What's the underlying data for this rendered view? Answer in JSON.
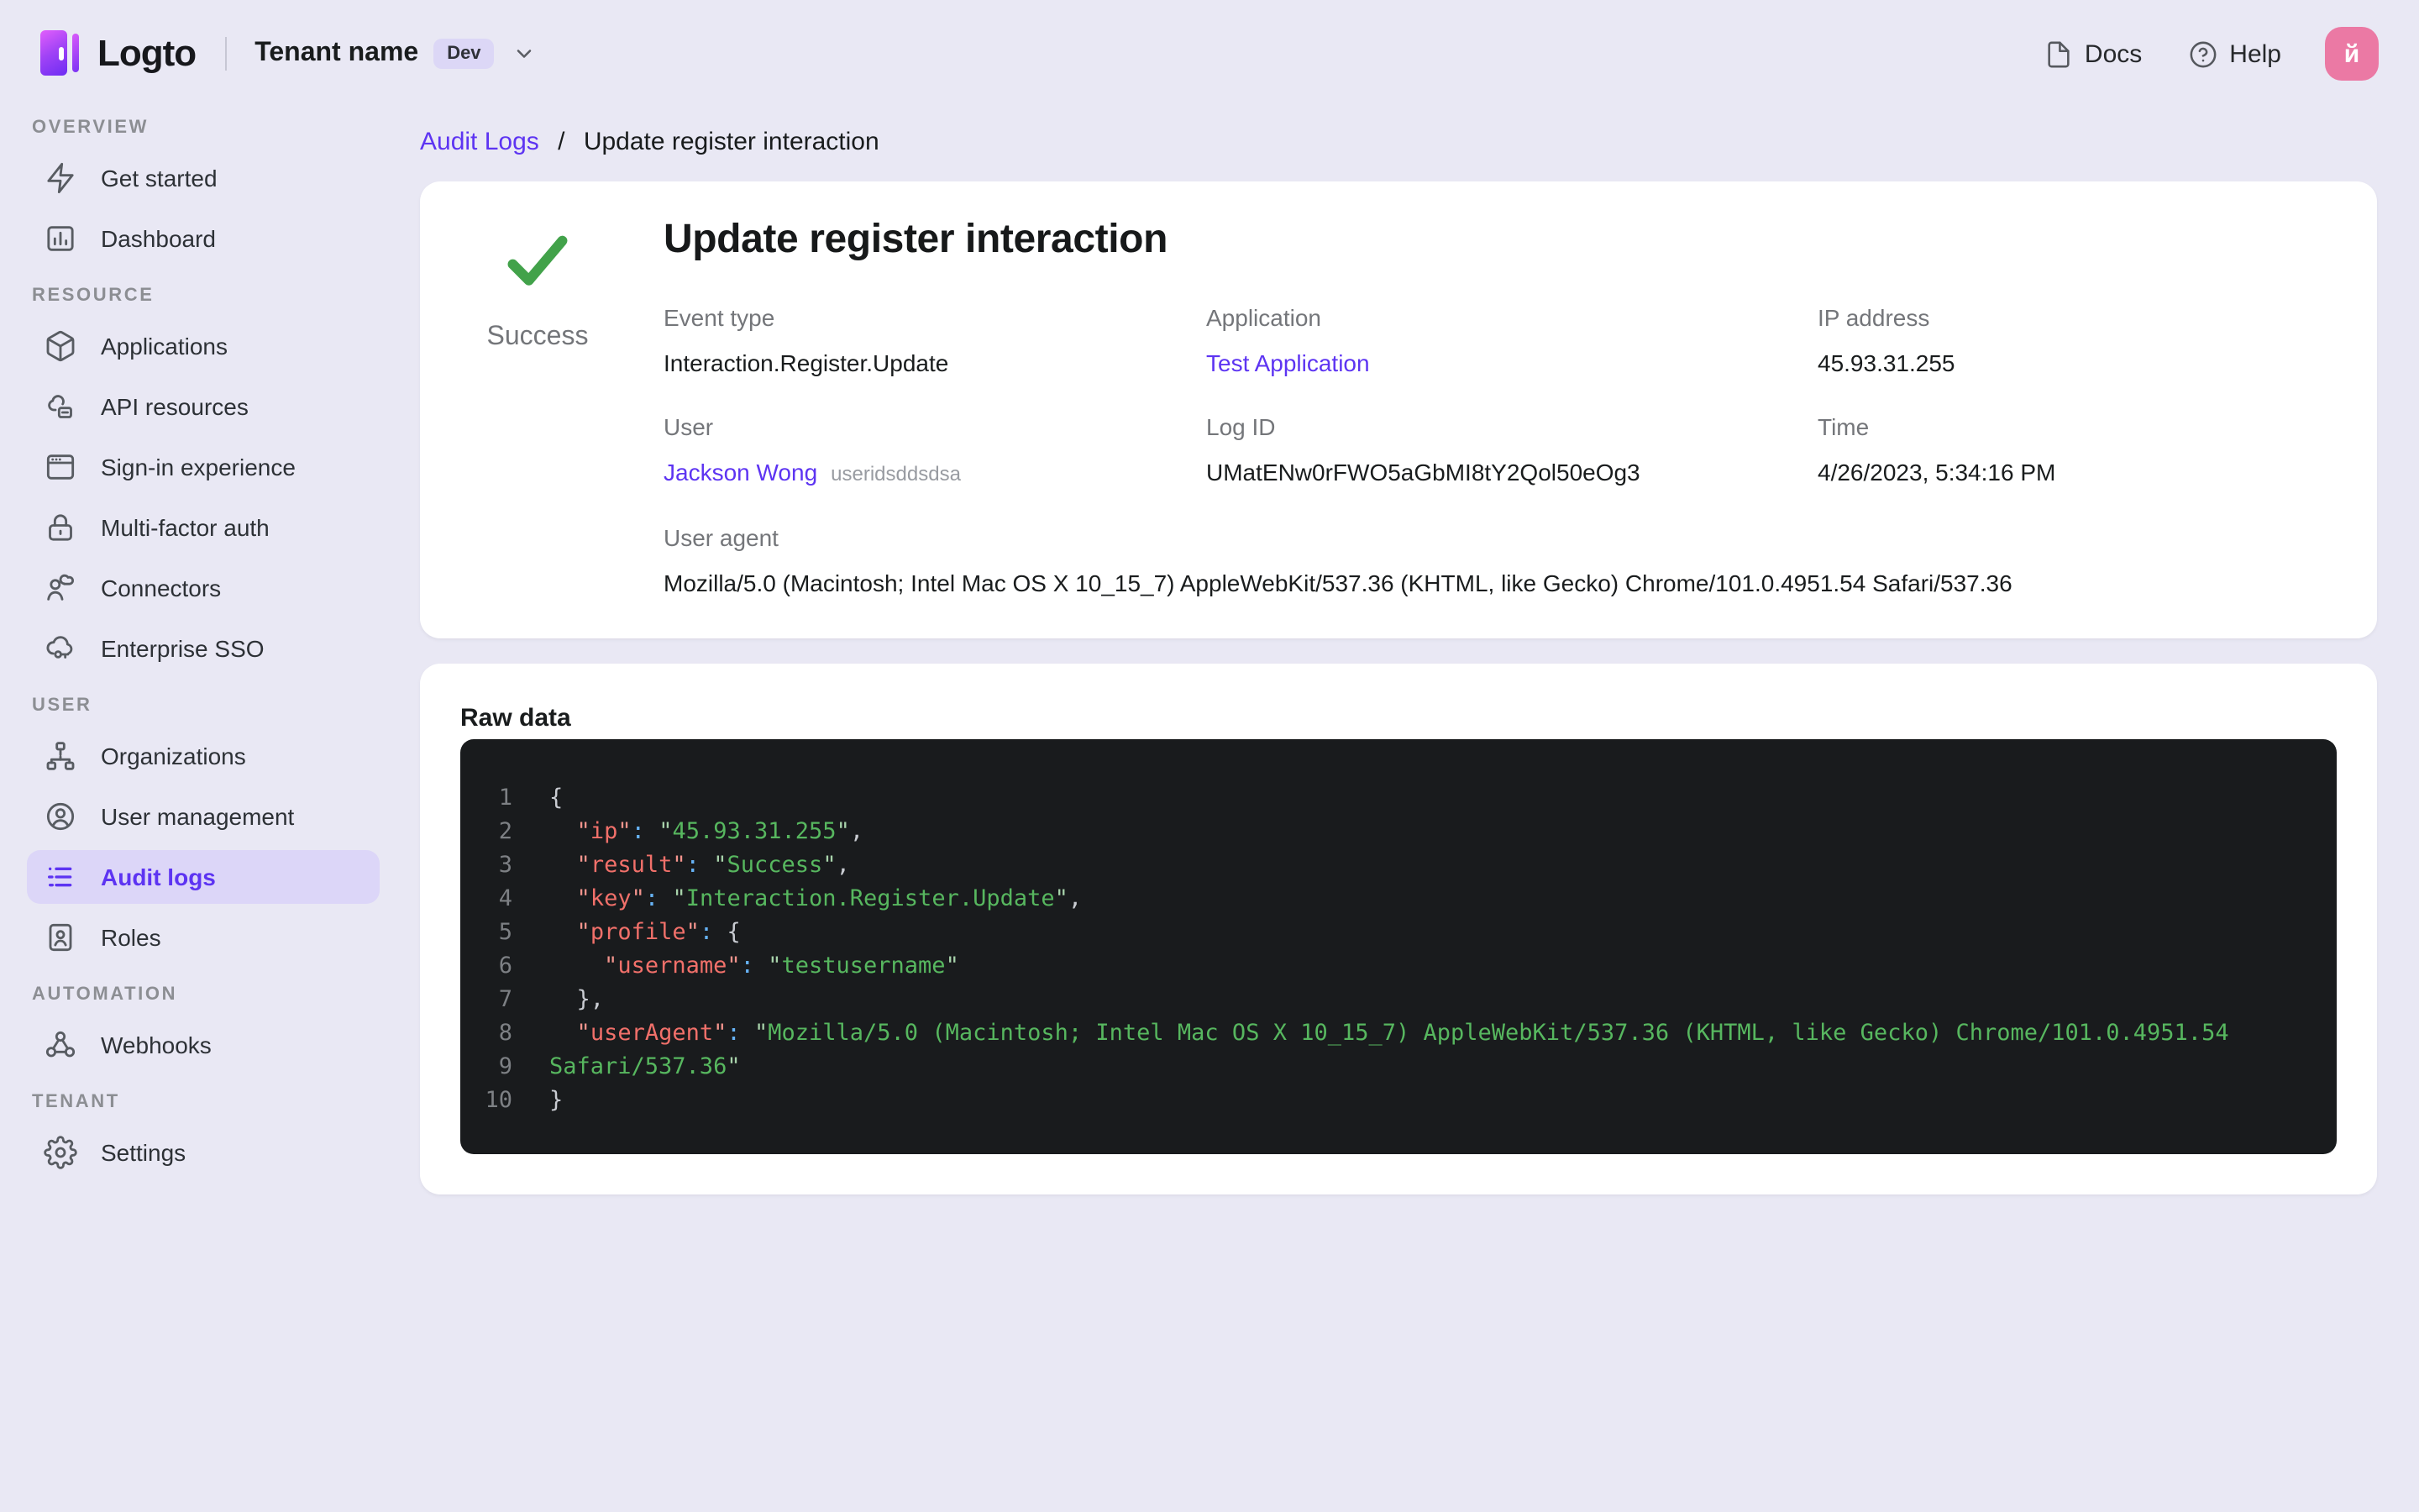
{
  "colors": {
    "brand_purple": "#5d34f2",
    "page_background": "#e9e8f4",
    "active_nav_background": "#dcd6f8",
    "success_green": "#42a24a",
    "avatar_pink": "#eb79a4",
    "code_background": "#191b1d",
    "code_key": "#f1706a",
    "code_string": "#57b75f",
    "code_colon": "#66b2f5"
  },
  "topbar": {
    "logo_text": "Logto",
    "tenant_name": "Tenant name",
    "env_badge": "Dev",
    "docs_label": "Docs",
    "help_label": "Help",
    "avatar_initial": "й"
  },
  "sidebar": {
    "sections": [
      {
        "title": "OVERVIEW",
        "items": [
          {
            "label": "Get started",
            "icon": "lightning-icon",
            "active": false
          },
          {
            "label": "Dashboard",
            "icon": "bar-chart-icon",
            "active": false
          }
        ]
      },
      {
        "title": "RESOURCE",
        "items": [
          {
            "label": "Applications",
            "icon": "cube-icon",
            "active": false
          },
          {
            "label": "API resources",
            "icon": "cloud-box-icon",
            "active": false
          },
          {
            "label": "Sign-in experience",
            "icon": "browser-window-icon",
            "active": false
          },
          {
            "label": "Multi-factor auth",
            "icon": "lock-icon",
            "active": false
          },
          {
            "label": "Connectors",
            "icon": "person-cloud-icon",
            "active": false
          },
          {
            "label": "Enterprise SSO",
            "icon": "cloud-key-icon",
            "active": false
          }
        ]
      },
      {
        "title": "USER",
        "items": [
          {
            "label": "Organizations",
            "icon": "org-tree-icon",
            "active": false
          },
          {
            "label": "User management",
            "icon": "user-circle-icon",
            "active": false
          },
          {
            "label": "Audit logs",
            "icon": "audit-list-icon",
            "active": true
          },
          {
            "label": "Roles",
            "icon": "role-badge-icon",
            "active": false
          }
        ]
      },
      {
        "title": "AUTOMATION",
        "items": [
          {
            "label": "Webhooks",
            "icon": "webhook-icon",
            "active": false
          }
        ]
      },
      {
        "title": "TENANT",
        "items": [
          {
            "label": "Settings",
            "icon": "gear-icon",
            "active": false
          }
        ]
      }
    ]
  },
  "breadcrumb": {
    "parent": "Audit Logs",
    "separator": "/",
    "current": "Update register interaction"
  },
  "event": {
    "title": "Update register interaction",
    "status": "Success",
    "fields": {
      "event_type": {
        "label": "Event type",
        "value": "Interaction.Register.Update"
      },
      "application": {
        "label": "Application",
        "value": "Test Application"
      },
      "ip": {
        "label": "IP address",
        "value": "45.93.31.255"
      },
      "user": {
        "label": "User",
        "value": "Jackson Wong",
        "user_id": "useridsddsdsa"
      },
      "log_id": {
        "label": "Log ID",
        "value": "UMatENw0rFWO5aGbMI8tY2Qol50eOg3"
      },
      "time": {
        "label": "Time",
        "value": "4/26/2023, 5:34:16 PM"
      },
      "user_agent": {
        "label": "User agent",
        "value": "Mozilla/5.0 (Macintosh; Intel Mac OS X 10_15_7) AppleWebKit/537.36 (KHTML, like Gecko) Chrome/101.0.4951.54 Safari/537.36"
      }
    }
  },
  "raw_data": {
    "title": "Raw data",
    "lines": [
      {
        "num": "1",
        "tokens": [
          [
            "pun",
            "{"
          ]
        ]
      },
      {
        "num": "2",
        "tokens": [
          [
            "pun",
            "  "
          ],
          [
            "kq",
            "\""
          ],
          [
            "key",
            "ip"
          ],
          [
            "kq",
            "\""
          ],
          [
            "col",
            ":"
          ],
          [
            "pun",
            " "
          ],
          [
            "sq",
            "\""
          ],
          [
            "str",
            "45.93.31.255"
          ],
          [
            "sq",
            "\""
          ],
          [
            "pun",
            ","
          ]
        ]
      },
      {
        "num": "3",
        "tokens": [
          [
            "pun",
            "  "
          ],
          [
            "kq",
            "\""
          ],
          [
            "key",
            "result"
          ],
          [
            "kq",
            "\""
          ],
          [
            "col",
            ":"
          ],
          [
            "pun",
            " "
          ],
          [
            "sq",
            "\""
          ],
          [
            "str",
            "Success"
          ],
          [
            "sq",
            "\""
          ],
          [
            "pun",
            ","
          ]
        ]
      },
      {
        "num": "4",
        "tokens": [
          [
            "pun",
            "  "
          ],
          [
            "kq",
            "\""
          ],
          [
            "key",
            "key"
          ],
          [
            "kq",
            "\""
          ],
          [
            "col",
            ":"
          ],
          [
            "pun",
            " "
          ],
          [
            "sq",
            "\""
          ],
          [
            "str",
            "Interaction.Register.Update"
          ],
          [
            "sq",
            "\""
          ],
          [
            "pun",
            ","
          ]
        ]
      },
      {
        "num": "5",
        "tokens": [
          [
            "pun",
            "  "
          ],
          [
            "kq",
            "\""
          ],
          [
            "key",
            "profile"
          ],
          [
            "kq",
            "\""
          ],
          [
            "col",
            ":"
          ],
          [
            "pun",
            " {"
          ]
        ]
      },
      {
        "num": "6",
        "tokens": [
          [
            "pun",
            "    "
          ],
          [
            "kq",
            "\""
          ],
          [
            "key",
            "username"
          ],
          [
            "kq",
            "\""
          ],
          [
            "col",
            ":"
          ],
          [
            "pun",
            " "
          ],
          [
            "sq",
            "\""
          ],
          [
            "str",
            "testusername"
          ],
          [
            "sq",
            "\""
          ]
        ]
      },
      {
        "num": "7",
        "tokens": [
          [
            "pun",
            "  },"
          ]
        ]
      },
      {
        "num": "8",
        "tokens": [
          [
            "pun",
            "  "
          ],
          [
            "kq",
            "\""
          ],
          [
            "key",
            "userAgent"
          ],
          [
            "kq",
            "\""
          ],
          [
            "col",
            ":"
          ],
          [
            "pun",
            " "
          ],
          [
            "sq",
            "\""
          ],
          [
            "str",
            "Mozilla/5.0 (Macintosh; Intel Mac OS X 10_15_7) AppleWebKit/537.36 (KHTML, like Gecko) Chrome/101.0.4951.54"
          ]
        ]
      },
      {
        "num": "9",
        "tokens": [
          [
            "str",
            "Safari/537.36"
          ],
          [
            "sq",
            "\""
          ]
        ]
      },
      {
        "num": "10",
        "tokens": [
          [
            "pun",
            "}"
          ]
        ]
      }
    ]
  }
}
